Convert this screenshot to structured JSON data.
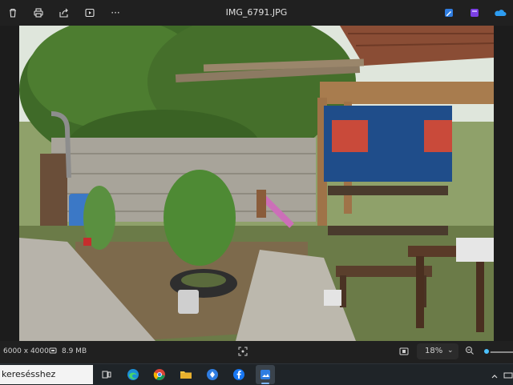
{
  "window": {
    "title": "IMG_6791.JPG"
  },
  "toolbar": {
    "left_icons": [
      "delete-icon",
      "print-icon",
      "share-icon",
      "video-editor-icon",
      "more-icon"
    ],
    "more_label": "···",
    "right_icons": [
      "edit-image-icon",
      "clipchamp-icon",
      "onedrive-icon"
    ]
  },
  "photo": {
    "description_icon": "garden-photo"
  },
  "status": {
    "dimensions": "6000 x 4000",
    "file_size": "8.9 MB",
    "zoom": "18%",
    "zoom_fraction": 0.18,
    "accent": "#4cc2ff"
  },
  "taskbar": {
    "search_placeholder": "keresésshez",
    "apps": [
      "task-view-icon",
      "edge-icon",
      "chrome-icon",
      "file-explorer-icon",
      "spotify-like-icon",
      "facebook-icon",
      "photos-icon"
    ]
  }
}
